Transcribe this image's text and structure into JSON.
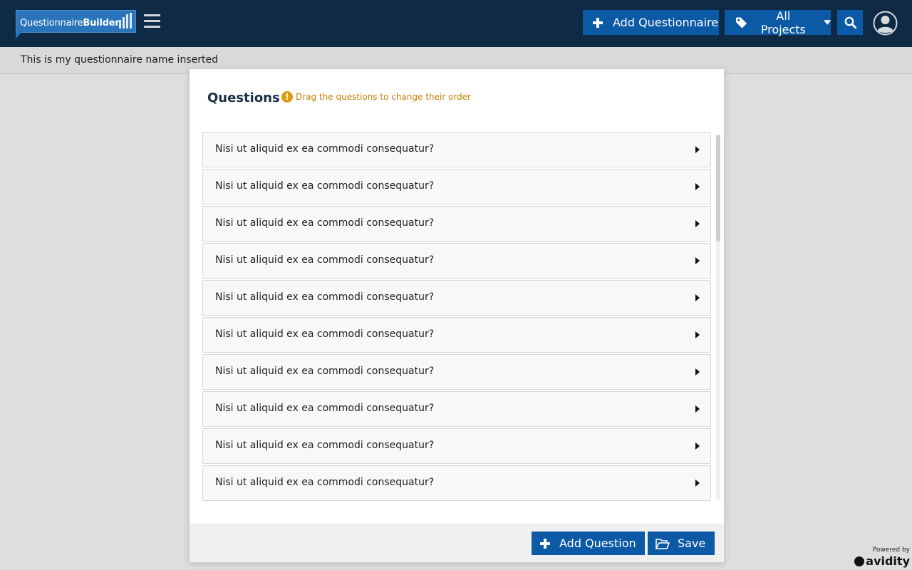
{
  "header": {
    "logo": {
      "part1": "Questionnaire",
      "part2": "Builder"
    },
    "menu_icon": "hamburger-icon",
    "add_questionnaire_label": "Add Questionnaire",
    "projects_label": "All Projects",
    "search_icon": "search-icon",
    "avatar_icon": "user-avatar-icon"
  },
  "subheader": {
    "title": "This is my questionnaire name inserted"
  },
  "modal": {
    "title": "Questions",
    "hint": "Drag the questions to change their order",
    "questions": [
      {
        "label": "Nisi ut aliquid ex ea commodi consequatur?"
      },
      {
        "label": "Nisi ut aliquid ex ea commodi consequatur?"
      },
      {
        "label": "Nisi ut aliquid ex ea commodi consequatur?"
      },
      {
        "label": "Nisi ut aliquid ex ea commodi consequatur?"
      },
      {
        "label": "Nisi ut aliquid ex ea commodi consequatur?"
      },
      {
        "label": "Nisi ut aliquid ex ea commodi consequatur?"
      },
      {
        "label": "Nisi ut aliquid ex ea commodi consequatur?"
      },
      {
        "label": "Nisi ut aliquid ex ea commodi consequatur?"
      },
      {
        "label": "Nisi ut aliquid ex ea commodi consequatur?"
      },
      {
        "label": "Nisi ut aliquid ex ea commodi consequatur?"
      }
    ],
    "footer": {
      "add_question_label": "Add Question",
      "save_label": "Save"
    }
  },
  "powered_by": {
    "small": "Powered by",
    "brand": "avidity"
  },
  "colors": {
    "navbar": "#0f2a44",
    "primary_button": "#0c5aa6",
    "hint": "#c77f00",
    "logo": "#2a74bb"
  }
}
